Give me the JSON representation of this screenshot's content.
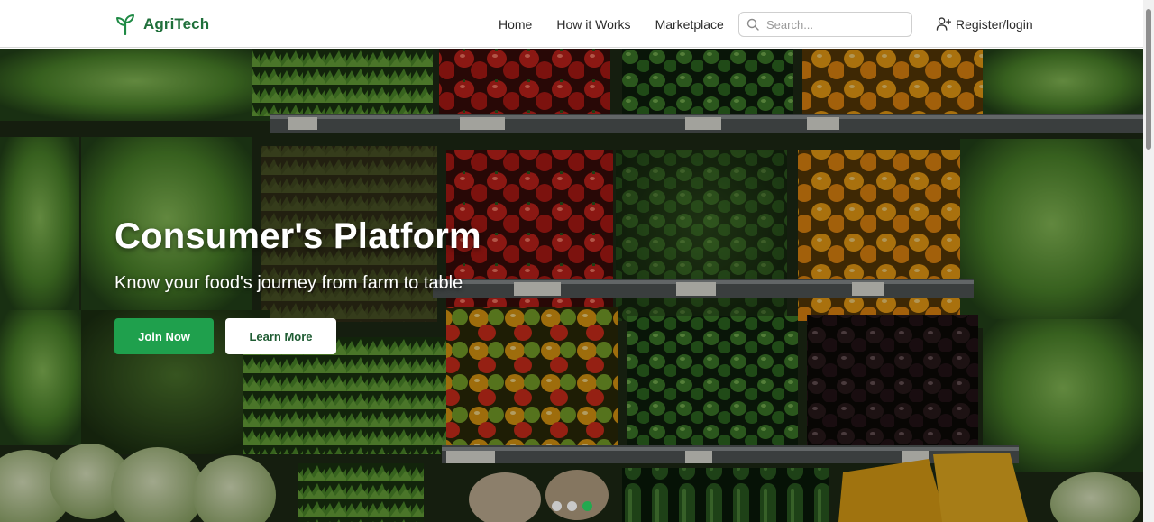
{
  "navbar": {
    "brand": {
      "name": "AgriTech",
      "icon": "sprout-icon",
      "color": "#1f6f3a"
    },
    "links": [
      "Home",
      "How it Works",
      "Marketplace"
    ],
    "search": {
      "placeholder": "Search...",
      "value": "",
      "icon": "search-icon"
    },
    "auth": {
      "label": "Register/login",
      "icon": "user-plus-icon"
    }
  },
  "hero": {
    "background": "produce-shelves-image",
    "title": "Consumer's Platform",
    "subtitle": "Know your food's journey from farm to table",
    "primary_button": {
      "label": "Join Now",
      "color": "#1fa04d"
    },
    "secondary_button": {
      "label": "Learn More"
    },
    "carousel": {
      "slides": 3,
      "active_index": 2,
      "active_color": "#22a94f"
    }
  }
}
